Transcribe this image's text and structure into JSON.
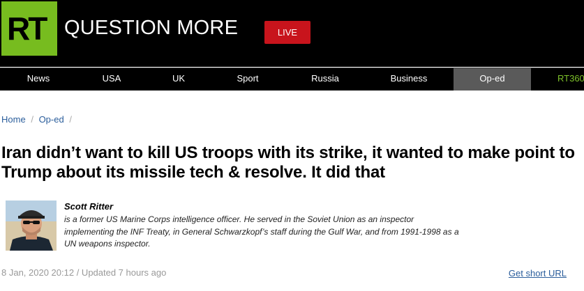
{
  "header": {
    "logo_text": "RT",
    "slogan": "QUESTION MORE",
    "live_label": "LIVE"
  },
  "nav": {
    "items": [
      {
        "label": "News"
      },
      {
        "label": "USA"
      },
      {
        "label": "UK"
      },
      {
        "label": "Sport"
      },
      {
        "label": "Russia"
      },
      {
        "label": "Business"
      },
      {
        "label": "Op-ed"
      },
      {
        "label": "RT360"
      }
    ],
    "active": "Op-ed"
  },
  "breadcrumb": {
    "home": "Home",
    "section": "Op-ed",
    "separator": "/"
  },
  "article": {
    "headline": "Iran didn’t want to kill US troops with its strike, it wanted to make point to Trump about its missile tech & resolve. It did that",
    "author": {
      "name": "Scott Ritter",
      "bio": "is a former US Marine Corps intelligence officer. He served in the Soviet Union as an inspector implementing the INF Treaty, in General Schwarzkopf’s staff during the Gulf War, and from 1991-1998 as a UN weapons inspector."
    },
    "dateline": "8 Jan, 2020 20:12 / Updated 7 hours ago",
    "short_url_label": "Get short URL"
  },
  "colors": {
    "brand_green": "#77bc1f",
    "live_red": "#c8141c",
    "nav_active": "#5a5a5a",
    "link_blue": "#2a5d9b",
    "rt360_green": "#7dc12a"
  }
}
